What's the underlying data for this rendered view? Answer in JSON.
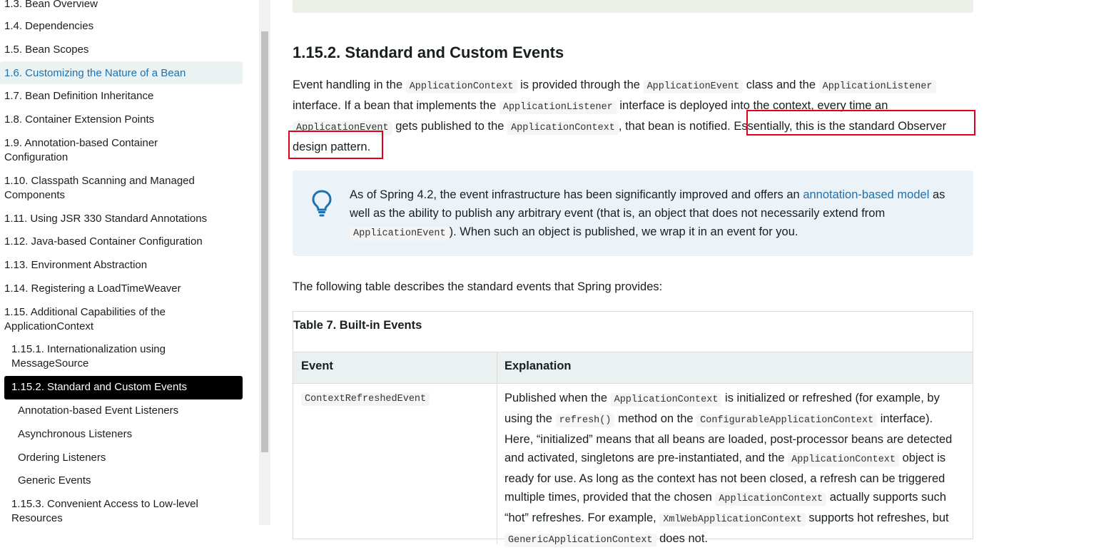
{
  "sidebar": {
    "items": [
      {
        "label": "1.3. Bean Overview"
      },
      {
        "label": "1.4. Dependencies"
      },
      {
        "label": "1.5. Bean Scopes"
      },
      {
        "label": "1.6. Customizing the Nature of a Bean"
      },
      {
        "label": "1.7. Bean Definition Inheritance"
      },
      {
        "label": "1.8. Container Extension Points"
      },
      {
        "label": "1.9. Annotation-based Container Configuration"
      },
      {
        "label": "1.10. Classpath Scanning and Managed Components"
      },
      {
        "label": "1.11. Using JSR 330 Standard Annotations"
      },
      {
        "label": "1.12. Java-based Container Configuration"
      },
      {
        "label": "1.13. Environment Abstraction"
      },
      {
        "label": "1.14. Registering a LoadTimeWeaver"
      },
      {
        "label": "1.15. Additional Capabilities of the ApplicationContext"
      },
      {
        "label": "1.15.1. Internationalization using MessageSource"
      },
      {
        "label": "1.15.2. Standard and Custom Events"
      },
      {
        "label": "Annotation-based Event Listeners"
      },
      {
        "label": "Asynchronous Listeners"
      },
      {
        "label": "Ordering Listeners"
      },
      {
        "label": "Generic Events"
      },
      {
        "label": "1.15.3. Convenient Access to Low-level Resources"
      }
    ]
  },
  "content": {
    "heading": "1.15.2. Standard and Custom Events",
    "p1": {
      "t1": "Event handling in the ",
      "c1": "ApplicationContext",
      "t2": " is provided through the ",
      "c2": "ApplicationEvent",
      "t3": " class and the ",
      "c3": "ApplicationListener",
      "t4": " interface. If a bean that implements the ",
      "c4": "ApplicationListener",
      "t5": " interface is deployed into the context, every time an ",
      "c5": "ApplicationEvent",
      "t6": " gets published to the ",
      "c6": "ApplicationContext",
      "t7": ", that bean is notified. ",
      "t8": "Essentially, this is the standard Observer design pattern."
    },
    "tip": {
      "t1": "As of Spring 4.2, the event infrastructure has been significantly improved and offers an ",
      "link": "annotation-based model",
      "t2": " as well as the ability to publish any arbitrary event (that is, an object that does not necessarily extend from ",
      "c1": "ApplicationEvent",
      "t3": "). When such an object is published, we wrap it in an event for you."
    },
    "p2": "The following table describes the standard events that Spring provides:",
    "table": {
      "caption": "Table 7. Built-in Events",
      "headers": [
        "Event",
        "Explanation"
      ],
      "row1": {
        "event": "ContextRefreshedEvent",
        "t1": "Published when the ",
        "c1": "ApplicationContext",
        "t2": " is initialized or refreshed (for example, by using the ",
        "c2": "refresh()",
        "t3": " method on the ",
        "c3": "ConfigurableApplicationContext",
        "t4": " interface). Here, “initialized” means that all beans are loaded, post-processor beans are detected and activated, singletons are pre-instantiated, and the ",
        "c4": "ApplicationContext",
        "t5": " object is ready for use. As long as the context has not been closed, a refresh can be triggered multiple times, provided that the chosen ",
        "c5": "ApplicationContext",
        "t6": " actually supports such “hot” refreshes. For example, ",
        "c6": "XmlWebApplicationContext",
        "t7": " supports hot refreshes, but ",
        "c7": "GenericApplicationContext",
        "t8": " does not."
      }
    }
  }
}
